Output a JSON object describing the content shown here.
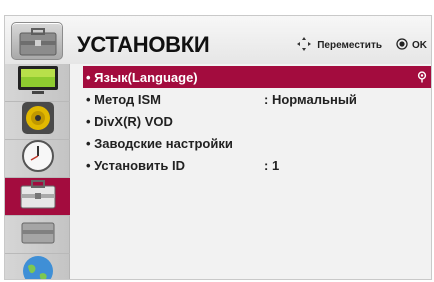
{
  "header": {
    "title": "УСТАНОВКИ",
    "move_label": "Переместить",
    "ok_label": "OK"
  },
  "side": {
    "items": [
      {
        "icon": "monitor-icon"
      },
      {
        "icon": "speaker-icon"
      },
      {
        "icon": "clock-icon"
      },
      {
        "icon": "toolbox-icon"
      },
      {
        "icon": "globe-icon"
      }
    ],
    "active_index": 3
  },
  "menu": {
    "items": [
      {
        "label": "• Язык(Language)",
        "value": ""
      },
      {
        "label": "• Метод ISM",
        "value": ": Нормальный"
      },
      {
        "label": "• DivX(R) VOD",
        "value": ""
      },
      {
        "label": "• Заводские настройки",
        "value": ""
      },
      {
        "label": "• Установить ID",
        "value": ": 1"
      }
    ],
    "selected_index": 0
  },
  "colors": {
    "accent": "#a30c3e",
    "sidebar": "#c8c8c8",
    "background": "#f2f2f2"
  }
}
